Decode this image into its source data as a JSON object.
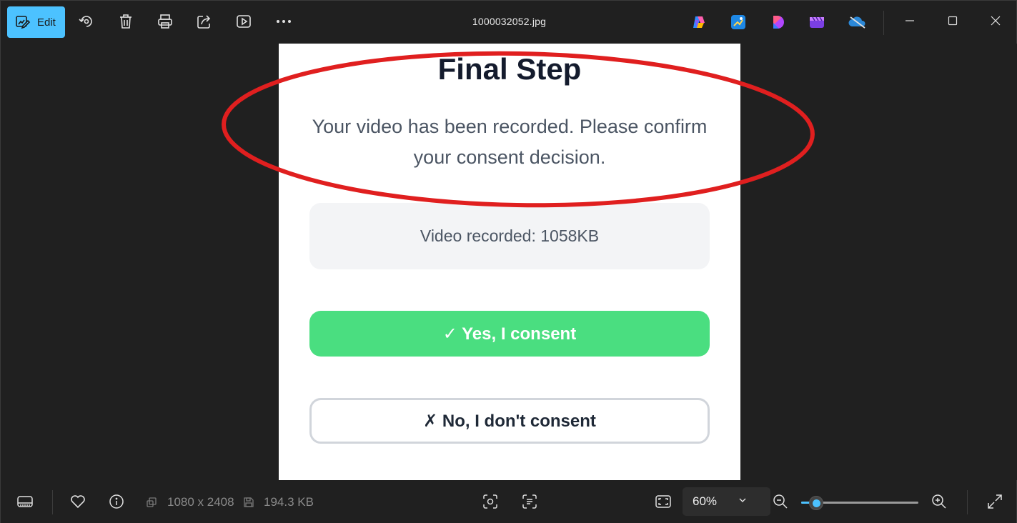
{
  "toolbar": {
    "edit_label": "Edit",
    "file_title": "1000032052.jpg",
    "accent": "#4cc2ff"
  },
  "document": {
    "title": "Final Step",
    "description": "Your video has been recorded. Please confirm your consent decision.",
    "info_text": "Video recorded: 1058KB",
    "yes_label": "✓ Yes, I consent",
    "no_label": "✗ No, I don't consent",
    "yes_color": "#4ade80",
    "annotation_color": "#e01f1f"
  },
  "statusbar": {
    "dimensions": "1080 x 2408",
    "file_size": "194.3 KB",
    "zoom_value": "60%",
    "zoom_fraction": 0.13
  },
  "icons": {
    "toolbar": [
      "edit-icon",
      "rotate-icon",
      "delete-icon",
      "print-icon",
      "share-icon",
      "slideshow-icon",
      "more-icon"
    ],
    "apps": [
      "copilot-icon",
      "photos-editor-icon",
      "designer-icon",
      "clipchamp-icon",
      "onedrive-icon"
    ],
    "window": [
      "minimize-icon",
      "maximize-icon",
      "close-icon"
    ],
    "bottom": [
      "filmstrip-icon",
      "favorite-icon",
      "info-icon",
      "ocr-icon",
      "text-scan-icon",
      "fit-window-icon",
      "zoom-out-icon",
      "zoom-in-icon",
      "fullscreen-icon"
    ]
  }
}
